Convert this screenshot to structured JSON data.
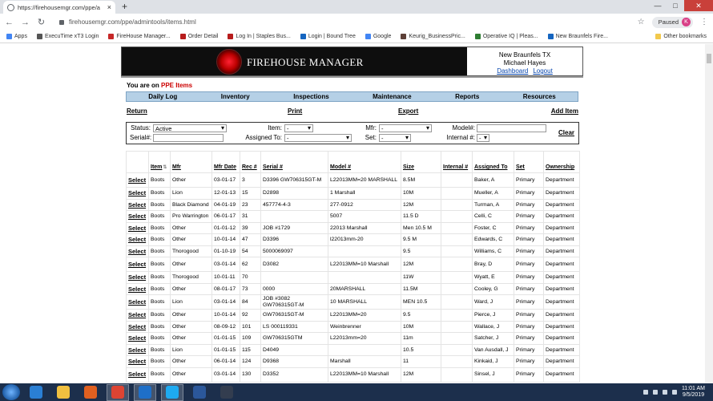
{
  "browser": {
    "tab_title": "https://firehousemgr.com/ppe/a",
    "tab_close": "×",
    "new_tab": "+",
    "url": "firehousemgr.com/ppe/admintools/items.html",
    "profile_status": "Paused",
    "profile_initial": "K",
    "bookmarks": [
      {
        "label": "Apps",
        "icon_color": "#4285f4",
        "icon": "apps-grid-icon"
      },
      {
        "label": "ExecuTime xT3 Login",
        "icon_color": "#555555",
        "icon": "star-icon"
      },
      {
        "label": "FireHouse Manager...",
        "icon_color": "#c62828",
        "icon": "firehouse-icon"
      },
      {
        "label": "Order Detail",
        "icon_color": "#b71c1c",
        "icon": "order-icon"
      },
      {
        "label": "Log In | Staples Bus...",
        "icon_color": "#b71c1c",
        "icon": "staples-icon"
      },
      {
        "label": "Login | Bound Tree",
        "icon_color": "#1565c0",
        "icon": "shield-icon"
      },
      {
        "label": "Google",
        "icon_color": "#4285f4",
        "icon": "google-icon"
      },
      {
        "label": "Keurig_BusinessPric...",
        "icon_color": "#5d4037",
        "icon": "document-icon"
      },
      {
        "label": "Operative IQ | Pleas...",
        "icon_color": "#2e7d32",
        "icon": "operative-icon"
      },
      {
        "label": "New Braunfels Fire...",
        "icon_color": "#1565c0",
        "icon": "badge-icon"
      }
    ],
    "other_bookmarks": "Other bookmarks"
  },
  "header": {
    "logo_text": "FIREHOUSE MANAGER",
    "org": "New Braunfels TX",
    "user": "Michael Hayes",
    "dashboard_link": "Dashboard",
    "logout_link": "Logout"
  },
  "breadcrumb": {
    "prefix": "You are on",
    "page": "PPE Items"
  },
  "nav": {
    "items": [
      "Daily Log",
      "Inventory",
      "Inspections",
      "Maintenance",
      "Reports",
      "Resources"
    ]
  },
  "actions": {
    "return": "Return",
    "print": "Print",
    "export": "Export",
    "add_item": "Add Item"
  },
  "filters": {
    "status_label": "Status:",
    "status_value": "Active",
    "item_label": "Item:",
    "item_value": "-",
    "mfr_label": "Mfr:",
    "mfr_value": "-",
    "model_label": "Model#:",
    "model_value": "",
    "serial_label": "Serial#:",
    "serial_value": "",
    "assigned_label": "Assigned To:",
    "assigned_value": "-",
    "set_label": "Set:",
    "set_value": "-",
    "internal_label": "Internal #:",
    "internal_value": "-",
    "clear": "Clear"
  },
  "table": {
    "select_label": "Select",
    "columns": [
      "",
      "Item",
      "Mfr",
      "Mfr Date",
      "Rec #",
      "Serial #",
      "Model #",
      "Size",
      "Internal #",
      "Assigned To",
      "Set",
      "Ownership"
    ],
    "rows": [
      [
        "Boots",
        "Other",
        "03-01-17",
        "3",
        "D3396 GW706315GT-M",
        "L22013MM=20 MARSHALL",
        "8.5M",
        "",
        "Baker, A",
        "Primary",
        "Department"
      ],
      [
        "Boots",
        "Lion",
        "12-01-13",
        "15",
        "D2898",
        "1 Marshall",
        "10M",
        "",
        "Mueller, A",
        "Primary",
        "Department"
      ],
      [
        "Boots",
        "Black Diamond",
        "04-01-19",
        "23",
        "457774-4-3",
        "277-0912",
        "12M",
        "",
        "Turman, A",
        "Primary",
        "Department"
      ],
      [
        "Boots",
        "Pro Warrington",
        "06-01-17",
        "31",
        "",
        "5007",
        "11.5 D",
        "",
        "Celli, C",
        "Primary",
        "Department"
      ],
      [
        "Boots",
        "Other",
        "01-01-12",
        "39",
        "JOB #1729",
        "22013 Marshall",
        "Men 10.5 M",
        "",
        "Foster, C",
        "Primary",
        "Department"
      ],
      [
        "Boots",
        "Other",
        "10-01-14",
        "47",
        "D3396",
        "l22013mm-20",
        "9.5 M",
        "",
        "Edwards, C",
        "Primary",
        "Department"
      ],
      [
        "Boots",
        "Thorogood",
        "01-10-19",
        "54",
        "5000069097",
        "",
        "9.5",
        "",
        "Williams, C",
        "Primary",
        "Department"
      ],
      [
        "Boots",
        "Other",
        "03-01-14",
        "62",
        "D3082",
        "L22013MM=10 Marshall",
        "12M",
        "",
        "Bray, D",
        "Primary",
        "Department"
      ],
      [
        "Boots",
        "Thorogood",
        "10-01-11",
        "70",
        "",
        "",
        "11W",
        "",
        "Wyatt, E",
        "Primary",
        "Department"
      ],
      [
        "Boots",
        "Other",
        "08-01-17",
        "73",
        "0000",
        "20MARSHALL",
        "11.5M",
        "",
        "Cooley, G",
        "Primary",
        "Department"
      ],
      [
        "Boots",
        "Lion",
        "03-01-14",
        "84",
        "JOB #3082 GW706315GT-M",
        "10 MARSHALL",
        "MEN 10.5",
        "",
        "Ward, J",
        "Primary",
        "Department"
      ],
      [
        "Boots",
        "Other",
        "10-01-14",
        "92",
        "GW706315GT-M",
        "L22013MM=20",
        "9.5",
        "",
        "Pierce, J",
        "Primary",
        "Department"
      ],
      [
        "Boots",
        "Other",
        "08-09-12",
        "101",
        "LS 000119331",
        "Weinbrenner",
        "10M",
        "",
        "Wallace, J",
        "Primary",
        "Department"
      ],
      [
        "Boots",
        "Other",
        "01-01-15",
        "109",
        "GW706315GTM",
        "L22013mm=20",
        "11m",
        "",
        "Satcher, J",
        "Primary",
        "Department"
      ],
      [
        "Boots",
        "Lion",
        "01-01-15",
        "115",
        "D4049",
        "",
        "10.5",
        "",
        "Van Ausdall, J",
        "Primary",
        "Department"
      ],
      [
        "Boots",
        "Other",
        "06-01-14",
        "124",
        "D9368",
        "Marshall",
        "11",
        "",
        "Kinkaid, J",
        "Primary",
        "Department"
      ],
      [
        "Boots",
        "Other",
        "03-01-14",
        "130",
        "D3352",
        "L22013MM=10 Marshall",
        "12M",
        "",
        "Sinsel, J",
        "Primary",
        "Department"
      ]
    ]
  },
  "taskbar": {
    "time": "11:01 AM",
    "date": "9/5/2019",
    "apps": [
      {
        "name": "ie-icon",
        "color": "#2a7fd4"
      },
      {
        "name": "folder-icon",
        "color": "#f0c040"
      },
      {
        "name": "media-player-icon",
        "color": "#e06020"
      },
      {
        "name": "chrome-icon",
        "color": "#dd4433"
      },
      {
        "name": "outlook-icon",
        "color": "#1e6fc8"
      },
      {
        "name": "skype-icon",
        "color": "#1eaaf1"
      },
      {
        "name": "word-icon",
        "color": "#2b579a"
      },
      {
        "name": "app-icon",
        "color": "#333d4f"
      }
    ]
  }
}
